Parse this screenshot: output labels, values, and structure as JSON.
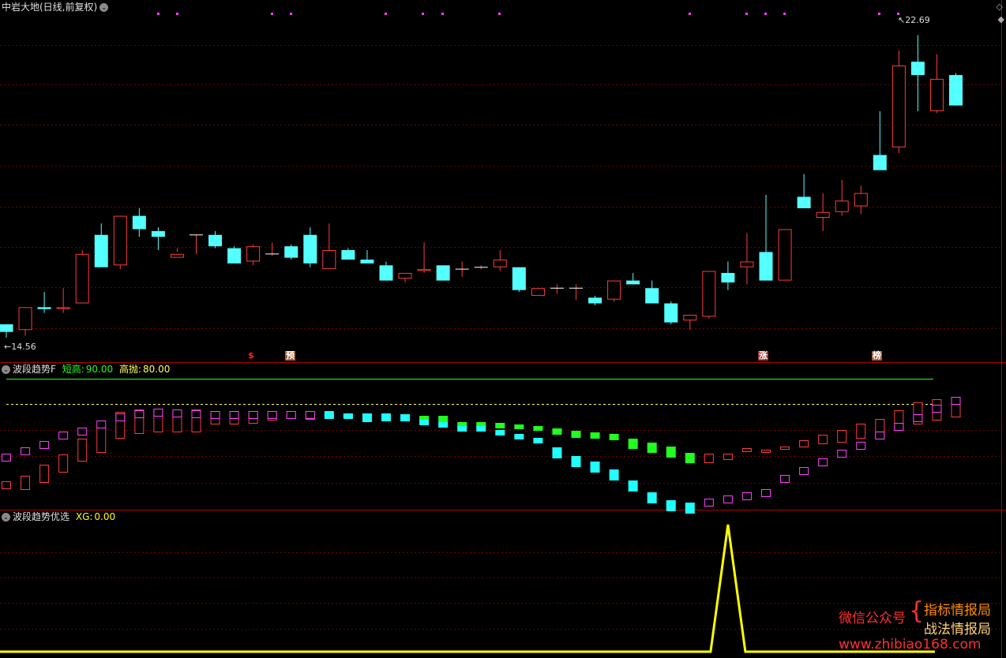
{
  "header": {
    "title": "中岩大地(日线,前复权)",
    "high_label": "22.69",
    "low_label": "14.56",
    "colors": {
      "up": "#ff3b3b",
      "down": "#54ffff",
      "grid": "#6e0000",
      "border": "#b00000"
    }
  },
  "markers": [
    {
      "text": "$",
      "color": "#ff2020"
    },
    {
      "text": "预",
      "color": "#ffffff",
      "bg": "#a05a30"
    },
    {
      "text": "涨",
      "color": "#ffffff",
      "bg": "#a03030"
    },
    {
      "text": "榜",
      "color": "#ffffff",
      "bg": "#a05a30"
    }
  ],
  "panel2": {
    "name": "波段趋势F",
    "f1_label": "短高:",
    "f1_value": "90.00",
    "f2_label": "高抛:",
    "f2_value": "80.00",
    "colors": {
      "f1": "#20ff20",
      "f2": "#ffff60"
    }
  },
  "panel3": {
    "name": "波段趋势优选",
    "xg_label": "XG:",
    "xg_value": "0.00",
    "color": "#ffff00"
  },
  "watermark": {
    "wechat": "微信公众号",
    "line1": "指标情报局",
    "line2": "战法情报局",
    "url": "www.zhibiao168.com"
  },
  "chart_data": {
    "type": "candlestick",
    "ohlc": [
      [
        15.0,
        15.0,
        14.65,
        14.8
      ],
      [
        14.85,
        15.45,
        14.7,
        15.45
      ],
      [
        15.45,
        15.85,
        15.3,
        15.4
      ],
      [
        15.4,
        15.95,
        15.3,
        15.45
      ],
      [
        15.55,
        16.95,
        15.55,
        16.85
      ],
      [
        17.35,
        17.65,
        16.5,
        16.5
      ],
      [
        16.55,
        17.85,
        16.45,
        17.85
      ],
      [
        17.85,
        18.05,
        17.3,
        17.5
      ],
      [
        17.45,
        17.55,
        16.95,
        17.3
      ],
      [
        16.75,
        17.0,
        16.9,
        16.85
      ],
      [
        17.35,
        17.35,
        16.85,
        17.35
      ],
      [
        17.35,
        17.45,
        17.0,
        17.05
      ],
      [
        17.0,
        17.05,
        16.6,
        16.6
      ],
      [
        16.65,
        17.1,
        16.55,
        17.05
      ],
      [
        16.85,
        17.15,
        16.8,
        16.85
      ],
      [
        17.05,
        17.1,
        16.7,
        16.75
      ],
      [
        17.35,
        17.55,
        16.5,
        16.6
      ],
      [
        16.45,
        17.65,
        16.45,
        16.95
      ],
      [
        16.95,
        17.0,
        16.7,
        16.7
      ],
      [
        16.7,
        16.95,
        16.65,
        16.6
      ],
      [
        16.55,
        16.65,
        16.15,
        16.15
      ],
      [
        16.2,
        16.35,
        16.1,
        16.35
      ],
      [
        16.4,
        17.15,
        16.35,
        16.45
      ],
      [
        16.55,
        16.55,
        16.15,
        16.15
      ],
      [
        16.45,
        16.65,
        16.25,
        16.45
      ],
      [
        16.5,
        16.55,
        16.45,
        16.5
      ],
      [
        16.5,
        16.95,
        16.4,
        16.7
      ],
      [
        16.5,
        16.5,
        15.85,
        15.9
      ],
      [
        15.75,
        15.95,
        15.75,
        15.95
      ],
      [
        15.95,
        16.05,
        15.8,
        15.95
      ],
      [
        15.95,
        16.05,
        15.65,
        15.95
      ],
      [
        15.7,
        15.75,
        15.5,
        15.55
      ],
      [
        15.65,
        16.15,
        15.6,
        16.15
      ],
      [
        16.15,
        16.35,
        16.15,
        16.05
      ],
      [
        15.95,
        16.15,
        15.75,
        15.55
      ],
      [
        15.55,
        15.6,
        15.0,
        15.05
      ],
      [
        15.1,
        15.15,
        14.85,
        15.25
      ],
      [
        15.2,
        16.4,
        15.15,
        16.4
      ],
      [
        16.35,
        16.65,
        15.9,
        16.1
      ],
      [
        16.5,
        17.4,
        16.05,
        16.65
      ],
      [
        16.9,
        18.4,
        16.4,
        16.15
      ],
      [
        16.15,
        17.5,
        16.15,
        17.5
      ],
      [
        18.35,
        18.95,
        18.35,
        18.05
      ],
      [
        17.8,
        18.45,
        17.45,
        17.95
      ],
      [
        17.95,
        18.8,
        17.85,
        18.25
      ],
      [
        18.1,
        18.65,
        17.9,
        18.45
      ],
      [
        19.45,
        20.6,
        19.3,
        19.05
      ],
      [
        19.65,
        22.2,
        19.5,
        21.8
      ],
      [
        21.9,
        22.6,
        20.6,
        21.55
      ],
      [
        20.6,
        22.1,
        20.55,
        21.45
      ],
      [
        21.55,
        21.6,
        20.75,
        20.75
      ]
    ],
    "y_range": [
      14.4,
      22.9
    ],
    "high": 22.69,
    "low": 14.56
  },
  "trend_data": {
    "upper": [
      0.45,
      0.43,
      0.4,
      0.38,
      0.33,
      0.26,
      0.21,
      0.22,
      0.2,
      0.21,
      0.2,
      0.17,
      0.17,
      0.16,
      0.16,
      0.18,
      0.18,
      0.19,
      0.16,
      0.17,
      0.17,
      0.16,
      0.17,
      0.17,
      0.17,
      0.17,
      0.2,
      0.2,
      0.22,
      0.23,
      0.23,
      0.24,
      0.24,
      0.25,
      0.26,
      0.25,
      0.2,
      0.19,
      0.18,
      0.18,
      0.18,
      0.18,
      0.17,
      0.18,
      0.19,
      0.2,
      0.21,
      0.2,
      0.2,
      0.2,
      0.2
    ],
    "lower": [
      0.31,
      0.31,
      0.33,
      0.32,
      0.3,
      0.23,
      0.18,
      0.17,
      0.16,
      0.15,
      0.14,
      0.13,
      0.12,
      0.11,
      0.12,
      0.13,
      0.14,
      0.15,
      0.14,
      0.13,
      0.13,
      0.12,
      0.12,
      0.13,
      0.13,
      0.12,
      0.12,
      0.11,
      0.1,
      0.11,
      0.1,
      0.09,
      0.09,
      0.09,
      0.08,
      0.07,
      0.07,
      0.06,
      0.07,
      0.1,
      0.11,
      0.13,
      0.15,
      0.17,
      0.22,
      0.27,
      0.3,
      0.33,
      0.35,
      0.37,
      0.39
    ],
    "upper_top": [
      0.37,
      0.36,
      0.34,
      0.3,
      0.26,
      0.21,
      0.19,
      0.19,
      0.18,
      0.18,
      0.17,
      0.16,
      0.15,
      0.14,
      0.14,
      0.15,
      0.15,
      0.15,
      0.15,
      0.15,
      0.15,
      0.15,
      0.15,
      0.15,
      0.15,
      0.15,
      0.15,
      0.16,
      0.17,
      0.18,
      0.19,
      0.2,
      0.21,
      0.22,
      0.22,
      0.21,
      0.19,
      0.18,
      0.18,
      0.17,
      0.18,
      0.17,
      0.17,
      0.18,
      0.19,
      0.2,
      0.21,
      0.2,
      0.2,
      0.2,
      0.2
    ],
    "mode": [
      "r",
      "r",
      "r",
      "r",
      "r",
      "r",
      "r",
      "r",
      "r",
      "r",
      "r",
      "r",
      "r",
      "r",
      "r",
      "r",
      "r",
      "c",
      "c",
      "c",
      "c",
      "c",
      "g",
      "g",
      "g",
      "g",
      "g",
      "g",
      "g",
      "g",
      "g",
      "g",
      "g",
      "g",
      "g",
      "g",
      "g",
      "r",
      "r",
      "r",
      "r",
      "r",
      "r",
      "r",
      "r",
      "r",
      "r",
      "r",
      "r",
      "r",
      "r"
    ]
  },
  "xg_data": {
    "spike_index": 38,
    "spike_value": 1
  }
}
